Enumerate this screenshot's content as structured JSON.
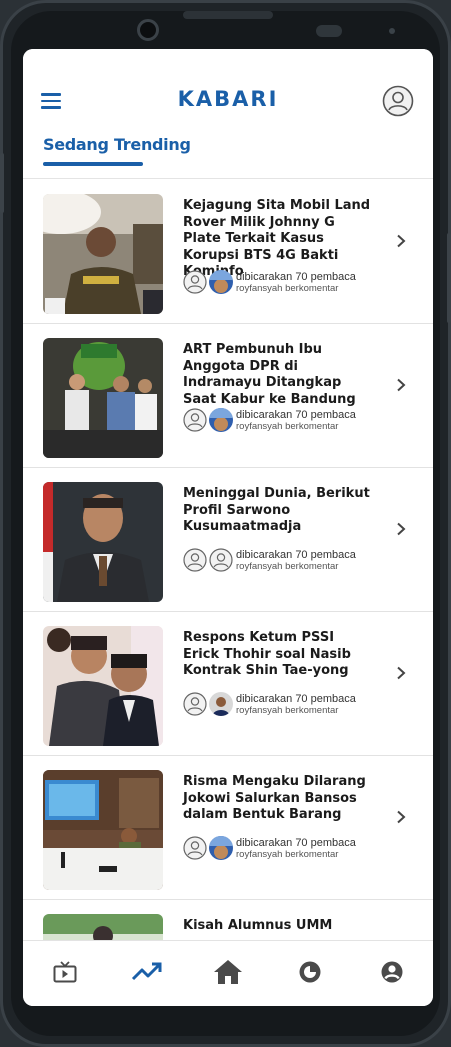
{
  "app": {
    "logo": "KABARI"
  },
  "header": {
    "tab_label": "Sedang Trending"
  },
  "articles": [
    {
      "title": "Kejagung Sita Mobil Land Rover Milik Johnny G Plate Terkait Kasus Korupsi BTS 4G Bakti Kominfo",
      "meta": "dibicarakan 70 pembaca",
      "commenter": "royfansyah berkomentar"
    },
    {
      "title": "ART Pembunuh Ibu Anggota DPR di Indramayu Ditangkap Saat Kabur ke Bandung",
      "meta": "dibicarakan 70 pembaca",
      "commenter": "royfansyah berkomentar"
    },
    {
      "title": "Meninggal Dunia, Berikut Profil Sarwono Kusumaatmadja",
      "meta": "dibicarakan 70 pembaca",
      "commenter": "royfansyah berkomentar"
    },
    {
      "title": "Respons Ketum PSSI Erick Thohir soal Nasib Kontrak Shin Tae-yong",
      "meta": "dibicarakan 70 pembaca",
      "commenter": "royfansyah berkomentar"
    },
    {
      "title": "Risma Mengaku Dilarang Jokowi Salurkan Bansos dalam Bentuk Barang",
      "meta": "dibicarakan 70 pembaca",
      "commenter": "royfansyah berkomentar"
    },
    {
      "title": "Kisah Alumnus UMM",
      "meta": "",
      "commenter": ""
    }
  ],
  "nav": [
    "tv-icon",
    "trending-icon",
    "home-icon",
    "discover-icon",
    "account-icon"
  ],
  "colors": {
    "accent": "#1a5fa8",
    "active_nav": "#1a5fa8",
    "inactive_nav": "#4a4a4a"
  }
}
